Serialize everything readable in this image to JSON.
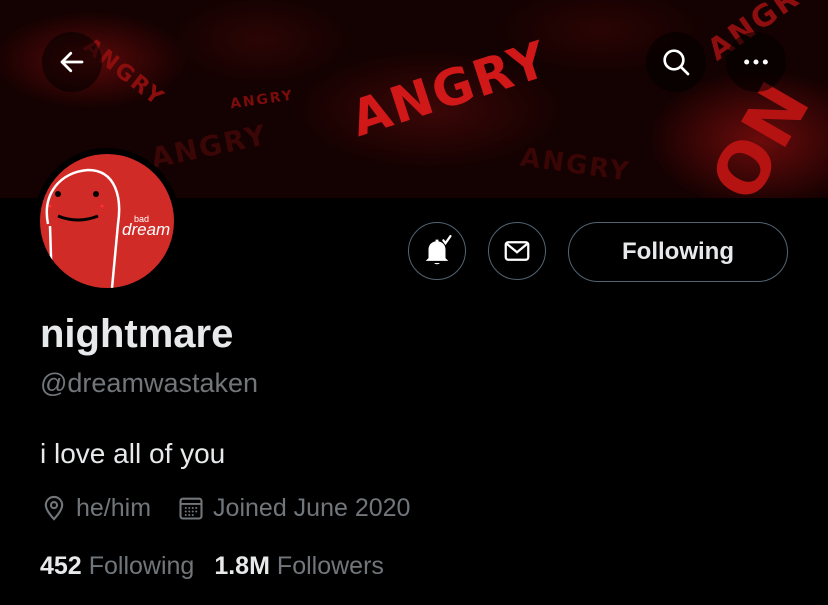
{
  "banner": {
    "words": [
      "ANGRY",
      "ANGRY",
      "ANGRY",
      "ON"
    ]
  },
  "header": {
    "back_icon": "arrow-left-icon",
    "search_icon": "search-icon",
    "more_icon": "more-horizontal-icon"
  },
  "avatar": {
    "small_text": "bad",
    "text": "dream",
    "background": "#d12b27"
  },
  "actions": {
    "bell_icon": "bell-notifications-on-icon",
    "message_icon": "envelope-icon",
    "following_label": "Following"
  },
  "profile": {
    "display_name": "nightmare",
    "handle": "@dreamwastaken",
    "bio": "i love all of you",
    "location_icon": "location-pin-icon",
    "location": "he/him",
    "joined_icon": "calendar-icon",
    "joined": "Joined June 2020"
  },
  "stats": {
    "following_count": "452",
    "following_label": "Following",
    "followers_count": "1.8M",
    "followers_label": "Followers"
  },
  "colors": {
    "background": "#000000",
    "text_primary": "#e7e9ea",
    "text_secondary": "#71767b",
    "border": "#536471",
    "banner_accent": "#c41414"
  }
}
